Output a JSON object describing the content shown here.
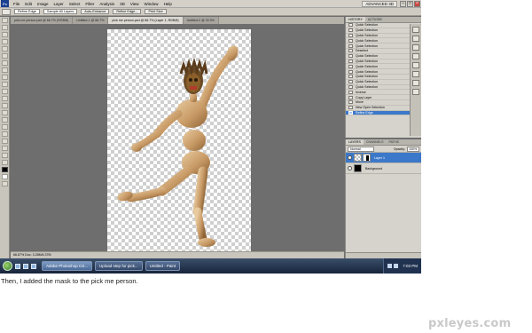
{
  "menu": {
    "logo": "Ps",
    "items": [
      "File",
      "Edit",
      "Image",
      "Layer",
      "Select",
      "Filter",
      "Analysis",
      "3D",
      "View",
      "Window",
      "Help"
    ],
    "workspace": "ADVANCED 3D"
  },
  "options": {
    "field1": "Refine Edge",
    "field2": "Sample All Layers",
    "btn1": "Auto-Enhance",
    "btn2": "Refine Edge...",
    "btn3": "Print Size"
  },
  "doc": {
    "tabs": [
      "pick me person.psd @ 66.7% (RGB/8)",
      "Untitled-1 @ 66.7%",
      "pick me person.psd @ 66.7% (Layer 1, RGB/8)",
      "Untitled-2 @ 33.3%"
    ],
    "status": "66.67%   Doc: 3.28M/4.37M"
  },
  "history": {
    "tabs": [
      "HISTORY",
      "ACTIONS"
    ],
    "items": [
      "Quick Selection",
      "Quick Selection",
      "Quick Selection",
      "Quick Selection",
      "Quick Selection",
      "Deselect",
      "Quick Selection",
      "Quick Selection",
      "Quick Selection",
      "Quick Selection",
      "Quick Selection",
      "Quick Selection",
      "Quick Selection",
      "Inverse",
      "Copy Layer",
      "Move",
      "New Open Selection",
      "Refine Edge"
    ]
  },
  "layers": {
    "tabs": [
      "LAYERS",
      "CHANNELS",
      "PATHS"
    ],
    "blend_mode": "Normal",
    "opacity_label": "Opacity:",
    "opacity_value": "100%",
    "rows": [
      {
        "name": "Layer 1"
      },
      {
        "name": "Background"
      }
    ]
  },
  "taskbar": {
    "buttons": [
      "Adobe Photoshop CS...",
      "Upload step for pick...",
      "Untitled - Paint"
    ],
    "clock": "7:03 PM"
  },
  "caption": "Then, I added the mask to the pick me person.",
  "watermark": "pxleyes.com"
}
